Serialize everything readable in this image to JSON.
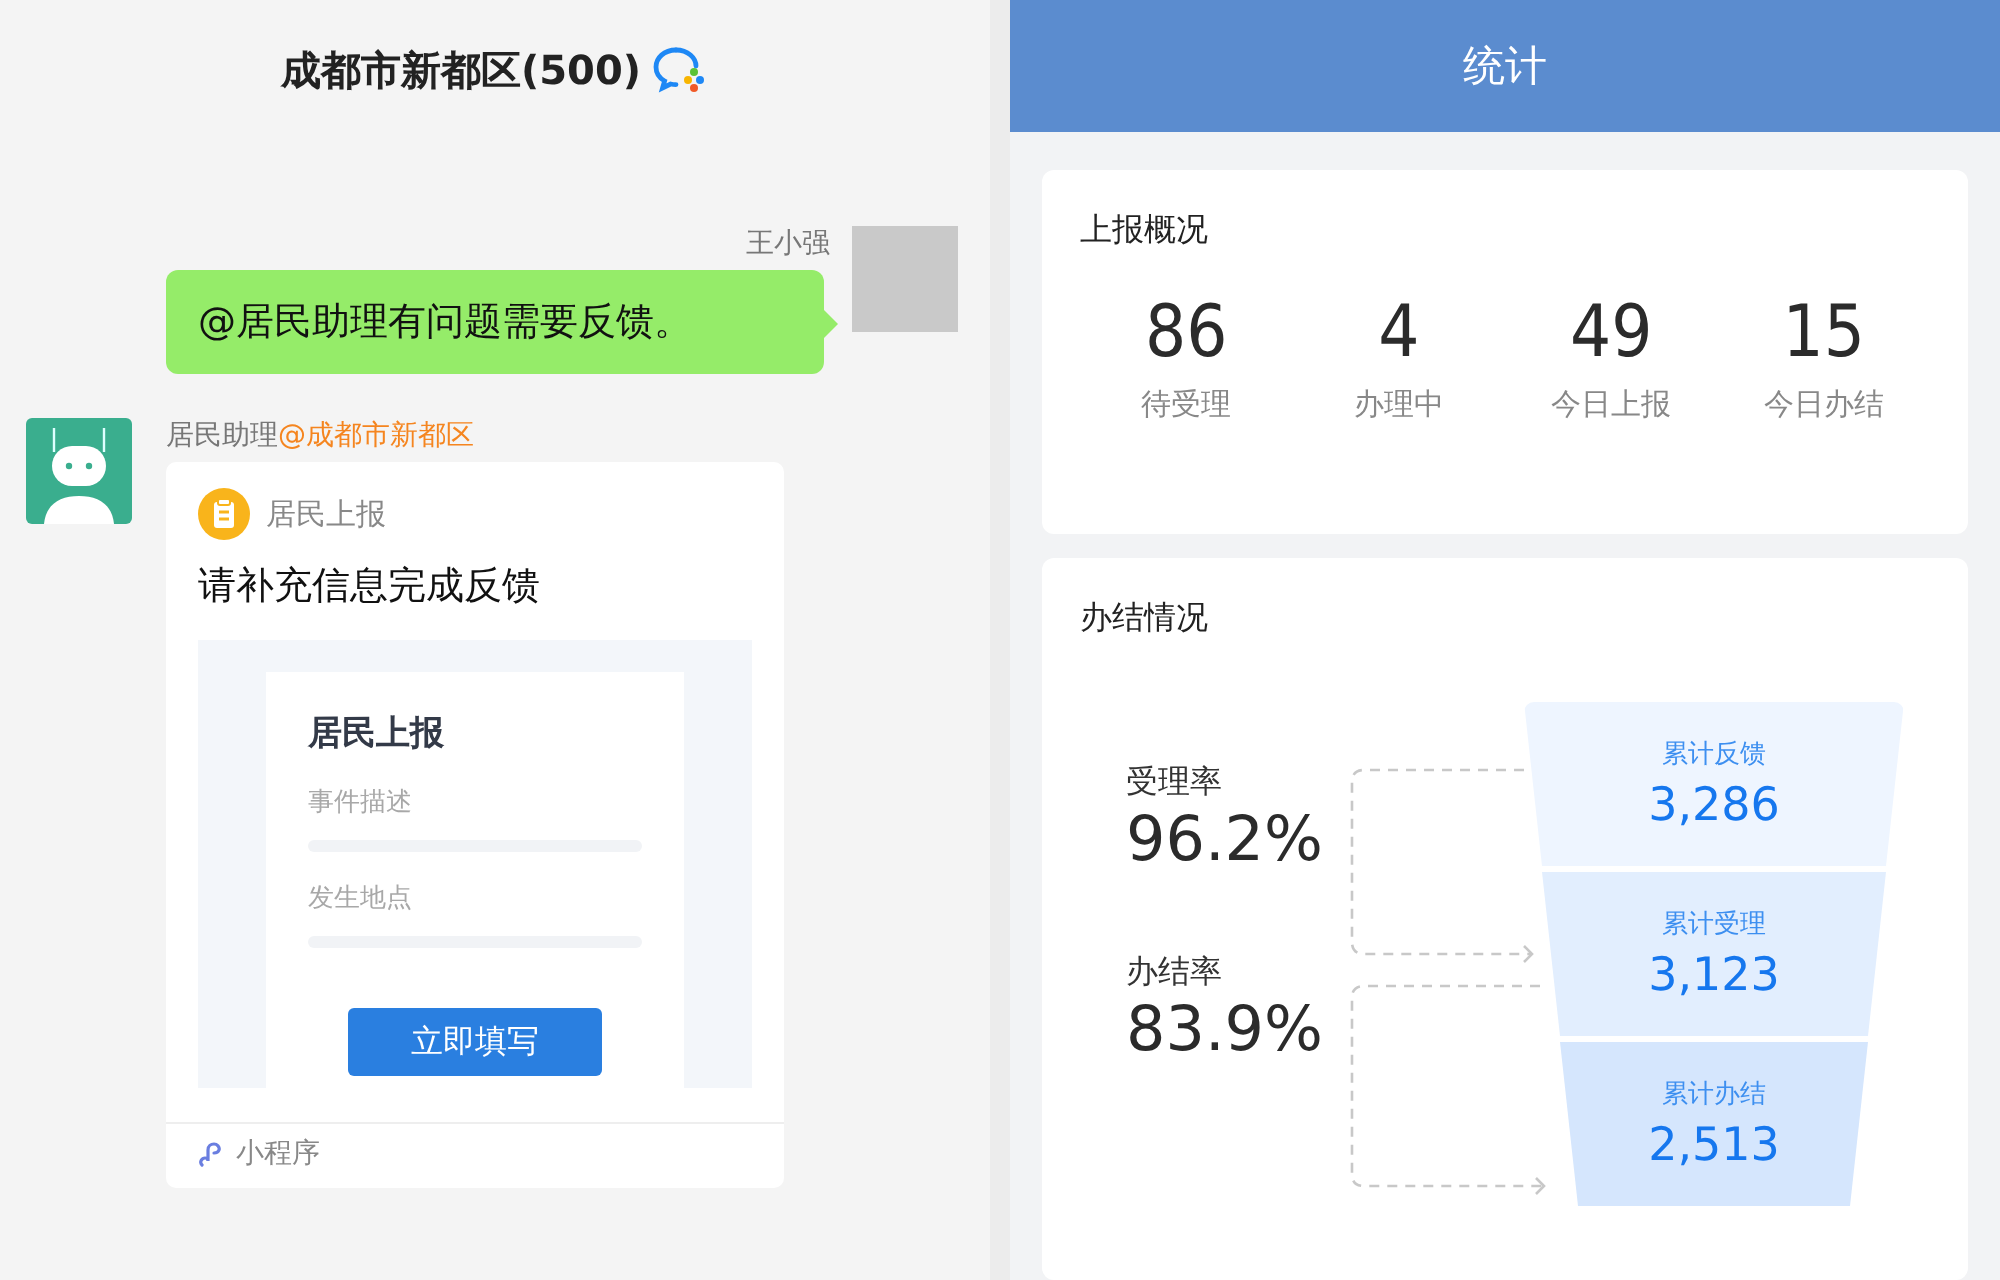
{
  "chat": {
    "title": "成都市新都区(500)",
    "outgoing": {
      "sender": "王小强",
      "text": "@居民助理有问题需要反馈。"
    },
    "incoming": {
      "sender": "居民助理",
      "mention": "@成都市新都区",
      "card": {
        "source": "居民上报",
        "title": "请补充信息完成反馈",
        "preview": {
          "title": "居民上报",
          "fields": [
            "事件描述",
            "发生地点"
          ],
          "button": "立即填写"
        },
        "footer": "小程序"
      }
    }
  },
  "stats": {
    "title": "统计",
    "overview": {
      "title": "上报概况",
      "items": [
        {
          "value": "86",
          "label": "待受理"
        },
        {
          "value": "4",
          "label": "办理中"
        },
        {
          "value": "49",
          "label": "今日上报"
        },
        {
          "value": "15",
          "label": "今日办结"
        }
      ]
    },
    "completion": {
      "title": "办结情况",
      "rates": [
        {
          "label": "受理率",
          "value": "96.2%"
        },
        {
          "label": "办结率",
          "value": "83.9%"
        }
      ],
      "funnel": [
        {
          "label": "累计反馈",
          "value": "3,286"
        },
        {
          "label": "累计受理",
          "value": "3,123"
        },
        {
          "label": "累计办结",
          "value": "2,513"
        }
      ]
    }
  }
}
